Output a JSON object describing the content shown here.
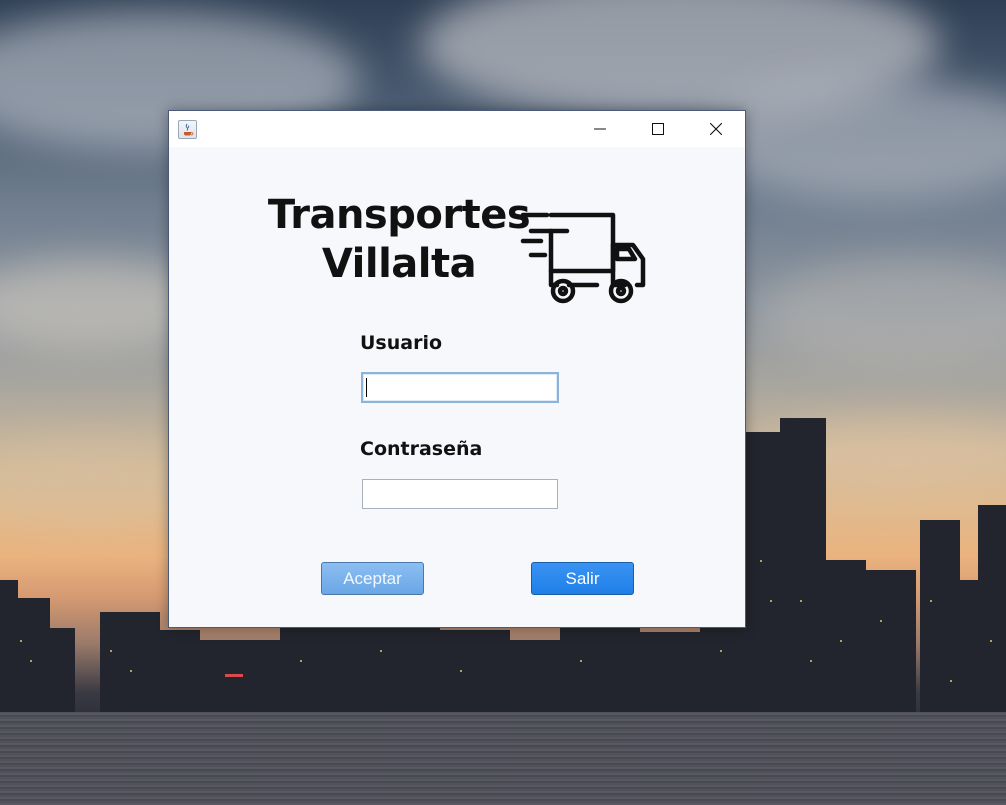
{
  "window": {
    "controls": {
      "minimize_icon": "minimize-icon",
      "maximize_icon": "maximize-icon",
      "close_icon": "close-icon"
    }
  },
  "brand": {
    "title_line1": "Transportes",
    "title_line2": "Villalta",
    "logo_icon": "delivery-truck-icon"
  },
  "form": {
    "user_label": "Usuario",
    "user_value": "",
    "password_label": "Contraseña",
    "password_value": ""
  },
  "buttons": {
    "accept_label": "Aceptar",
    "exit_label": "Salir"
  },
  "colors": {
    "accept_button": "#6aa6e6",
    "exit_button": "#1f7fe8",
    "dialog_background": "#f6f8fc"
  }
}
